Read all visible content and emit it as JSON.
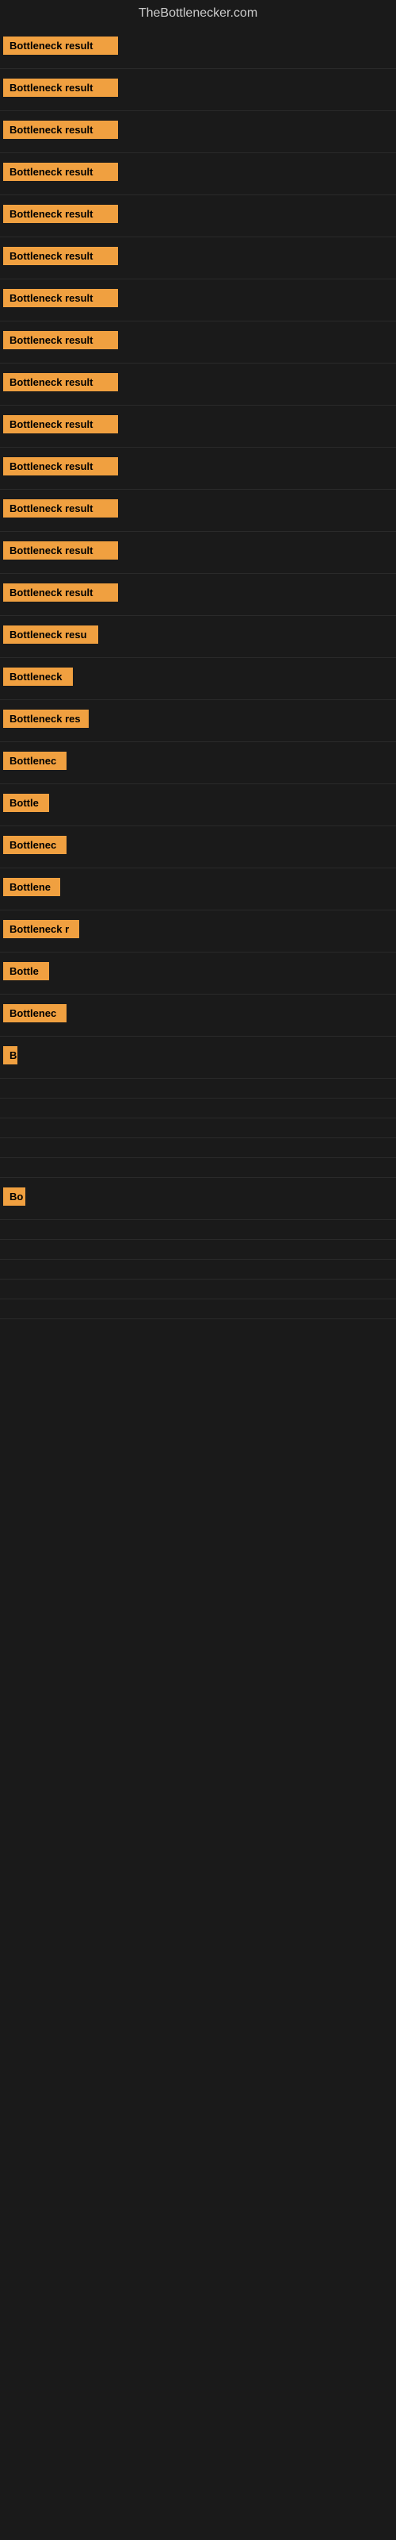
{
  "site": {
    "title": "TheBottlenecker.com"
  },
  "rows": [
    {
      "id": 1,
      "label": "Bottleneck result",
      "width": 145
    },
    {
      "id": 2,
      "label": "Bottleneck result",
      "width": 145
    },
    {
      "id": 3,
      "label": "Bottleneck result",
      "width": 145
    },
    {
      "id": 4,
      "label": "Bottleneck result",
      "width": 145
    },
    {
      "id": 5,
      "label": "Bottleneck result",
      "width": 145
    },
    {
      "id": 6,
      "label": "Bottleneck result",
      "width": 145
    },
    {
      "id": 7,
      "label": "Bottleneck result",
      "width": 145
    },
    {
      "id": 8,
      "label": "Bottleneck result",
      "width": 145
    },
    {
      "id": 9,
      "label": "Bottleneck result",
      "width": 145
    },
    {
      "id": 10,
      "label": "Bottleneck result",
      "width": 145
    },
    {
      "id": 11,
      "label": "Bottleneck result",
      "width": 145
    },
    {
      "id": 12,
      "label": "Bottleneck result",
      "width": 145
    },
    {
      "id": 13,
      "label": "Bottleneck result",
      "width": 145
    },
    {
      "id": 14,
      "label": "Bottleneck result",
      "width": 145
    },
    {
      "id": 15,
      "label": "Bottleneck resu",
      "width": 120
    },
    {
      "id": 16,
      "label": "Bottleneck",
      "width": 88
    },
    {
      "id": 17,
      "label": "Bottleneck res",
      "width": 108
    },
    {
      "id": 18,
      "label": "Bottlenec",
      "width": 80
    },
    {
      "id": 19,
      "label": "Bottle",
      "width": 58
    },
    {
      "id": 20,
      "label": "Bottlenec",
      "width": 80
    },
    {
      "id": 21,
      "label": "Bottlene",
      "width": 72
    },
    {
      "id": 22,
      "label": "Bottleneck r",
      "width": 96
    },
    {
      "id": 23,
      "label": "Bottle",
      "width": 58
    },
    {
      "id": 24,
      "label": "Bottlenec",
      "width": 80
    },
    {
      "id": 25,
      "label": "B",
      "width": 18
    },
    {
      "id": 26,
      "label": "",
      "width": 0
    },
    {
      "id": 27,
      "label": "",
      "width": 0
    },
    {
      "id": 28,
      "label": "",
      "width": 0
    },
    {
      "id": 29,
      "label": "",
      "width": 0
    },
    {
      "id": 30,
      "label": "",
      "width": 0
    },
    {
      "id": 31,
      "label": "Bo",
      "width": 28
    },
    {
      "id": 32,
      "label": "",
      "width": 0
    },
    {
      "id": 33,
      "label": "",
      "width": 0
    },
    {
      "id": 34,
      "label": "",
      "width": 0
    },
    {
      "id": 35,
      "label": "",
      "width": 0
    },
    {
      "id": 36,
      "label": "",
      "width": 0
    }
  ],
  "colors": {
    "bar_bg": "#f0a040",
    "bar_text": "#000000",
    "page_bg": "#1a1a1a",
    "title_text": "#cccccc"
  }
}
